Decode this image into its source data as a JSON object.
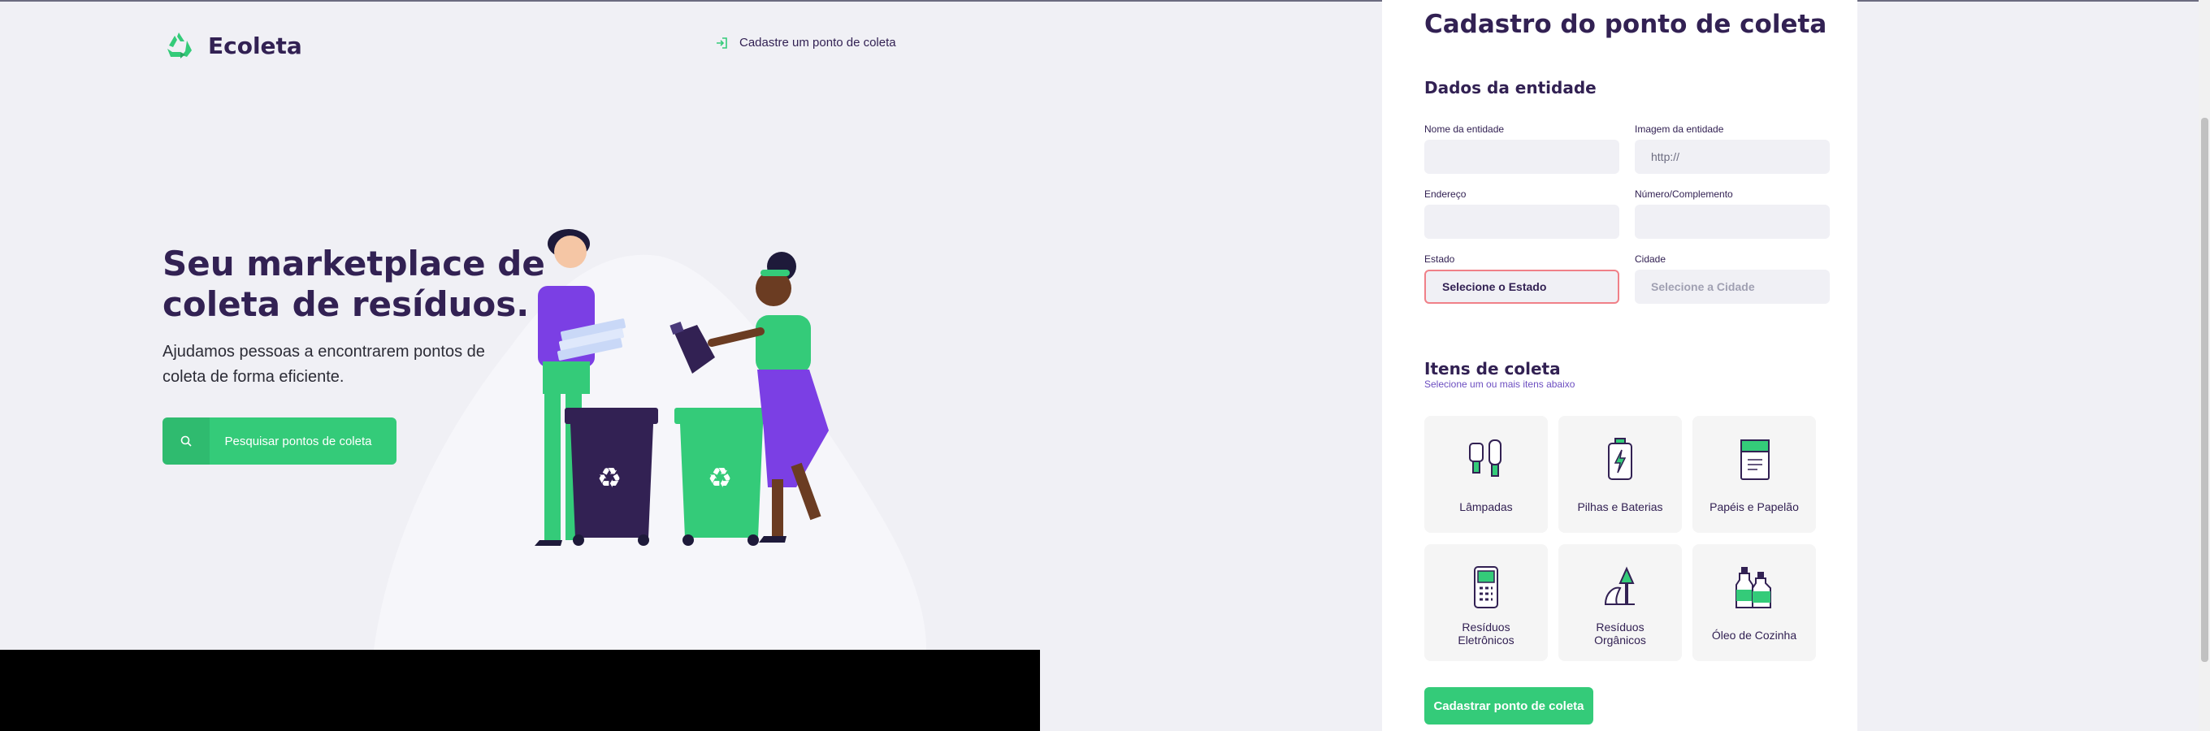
{
  "app": {
    "name": "Ecoleta"
  },
  "header": {
    "register_link": "Cadastre um ponto de coleta"
  },
  "hero": {
    "title": "Seu marketplace de coleta de resíduos.",
    "subtitle": "Ajudamos pessoas a encontrarem pontos de coleta de forma eficiente.",
    "search_button": "Pesquisar pontos de coleta"
  },
  "form": {
    "title": "Cadastro do ponto de coleta",
    "entity_section": "Dados da entidade",
    "fields": {
      "name": {
        "label": "Nome da entidade",
        "value": ""
      },
      "image": {
        "label": "Imagem da entidade",
        "value": "http://"
      },
      "address": {
        "label": "Endereço",
        "value": ""
      },
      "number": {
        "label": "Número/Complemento",
        "value": ""
      },
      "state": {
        "label": "Estado",
        "value": "Selecione o Estado"
      },
      "city": {
        "label": "Cidade",
        "value": "Selecione a Cidade"
      }
    },
    "items_section": "Itens de coleta",
    "items_hint": "Selecione um ou mais itens abaixo",
    "items": [
      {
        "label": "Lâmpadas",
        "icon": "lamp-icon"
      },
      {
        "label": "Pilhas e Baterias",
        "icon": "battery-icon"
      },
      {
        "label": "Papéis e Papelão",
        "icon": "paper-icon"
      },
      {
        "label": "Resíduos Eletrônicos",
        "icon": "electronics-icon"
      },
      {
        "label": "Resíduos Orgânicos",
        "icon": "organic-icon"
      },
      {
        "label": "Óleo de Cozinha",
        "icon": "oil-icon"
      }
    ],
    "submit": "Cadastrar ponto de coleta"
  },
  "colors": {
    "primary": "#34cb79",
    "title": "#322153",
    "background": "#f0f0f5"
  }
}
